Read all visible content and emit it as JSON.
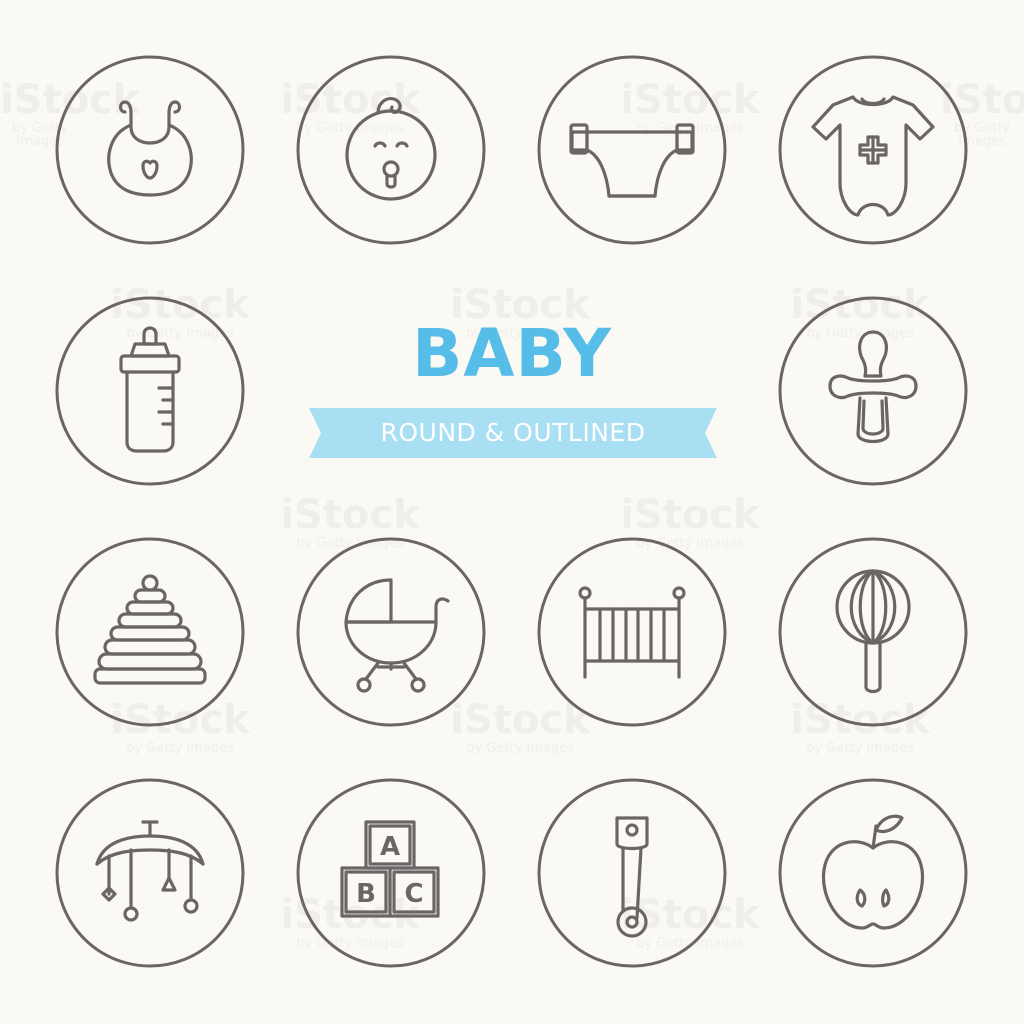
{
  "heading": {
    "title": "BABY",
    "subtitle": "ROUND & OUTLINED"
  },
  "colors": {
    "background": "#fbf9f4",
    "accent": "#55bde8",
    "ribbon": "#a9dff2",
    "stroke": "#6a6666"
  },
  "icons": [
    "bib-icon",
    "baby-face-icon",
    "diaper-icon",
    "bodysuit-icon",
    "baby-bottle-icon",
    "pacifier-icon",
    "stacking-rings-icon",
    "stroller-icon",
    "crib-icon",
    "rattle-icon",
    "crib-mobile-icon",
    "abc-blocks-icon",
    "safety-pin-icon",
    "apple-icon"
  ],
  "blocks": {
    "a": "A",
    "b": "B",
    "c": "C"
  },
  "watermark": {
    "main": "iStock",
    "sub": "by Getty Images"
  }
}
